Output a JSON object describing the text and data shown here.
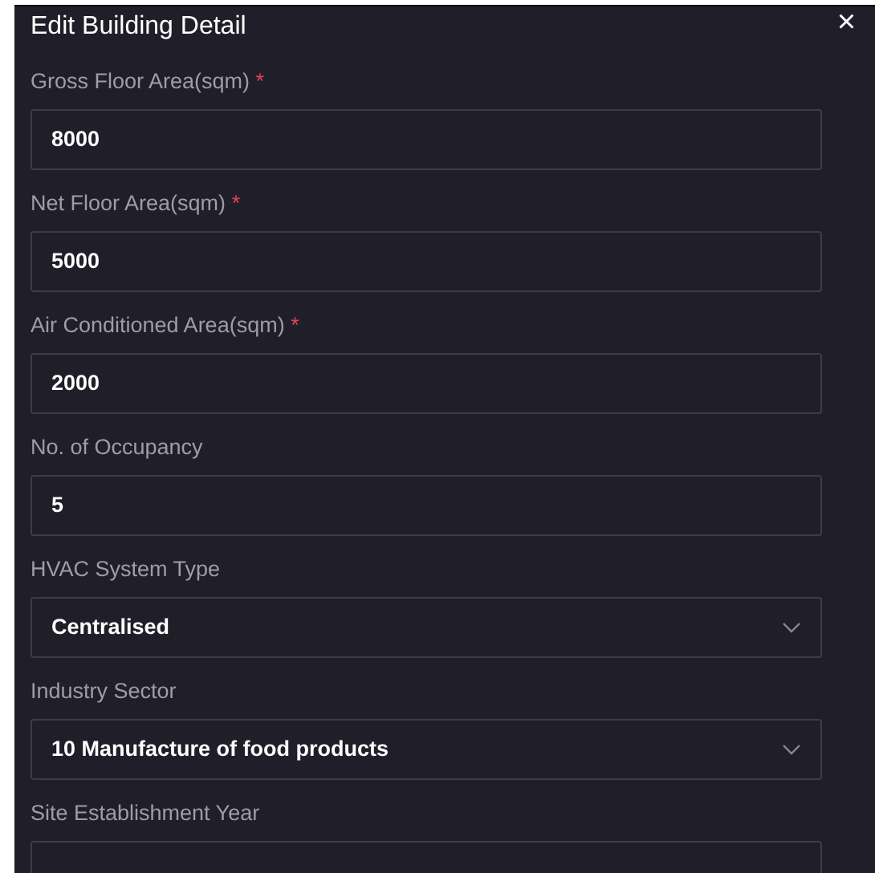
{
  "dialog": {
    "title": "Edit Building Detail",
    "close": "×"
  },
  "fields": [
    {
      "label": "Gross Floor Area(sqm)",
      "required_mark": "*",
      "kind": "text",
      "value": "8000"
    },
    {
      "label": "Net Floor Area(sqm)",
      "required_mark": "*",
      "kind": "text",
      "value": "5000"
    },
    {
      "label": "Air Conditioned Area(sqm)",
      "required_mark": "*",
      "kind": "text",
      "value": "2000"
    },
    {
      "label": "No. of Occupancy",
      "kind": "text",
      "value": "5"
    },
    {
      "label": "HVAC System Type",
      "kind": "select",
      "value": "Centralised"
    },
    {
      "label": "Industry Sector",
      "kind": "select",
      "value": "10 Manufacture of food products"
    },
    {
      "label": "Site Establishment Year",
      "kind": "text"
    }
  ]
}
